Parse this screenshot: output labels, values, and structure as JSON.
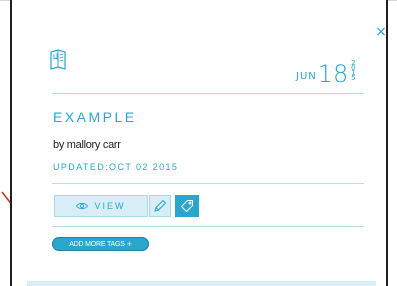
{
  "card": {
    "close_glyph": "×",
    "date": {
      "month": "JUN",
      "day": "18",
      "year_digits": [
        "2",
        "0",
        "1",
        "5"
      ]
    },
    "title": "EXAMPLE",
    "author": "by mallory carr",
    "updated": "UPDATED:OCT 02 2015",
    "actions": {
      "view_label": "VIEW"
    },
    "add_tags": {
      "label": "ADD MORE TAGS",
      "plus": "+"
    }
  },
  "icons": {
    "close": "close-icon",
    "book": "book-icon",
    "eye": "eye-icon",
    "pencil": "pencil-icon",
    "tag": "tag-icon",
    "annotation_arrow": "arrow-icon"
  },
  "colors": {
    "accent": "#2aa6cc",
    "accent_light": "#d7eef6",
    "rule": "#b7dde9",
    "text_dark": "#222222",
    "annotation_arrow": "#c23a2b"
  }
}
